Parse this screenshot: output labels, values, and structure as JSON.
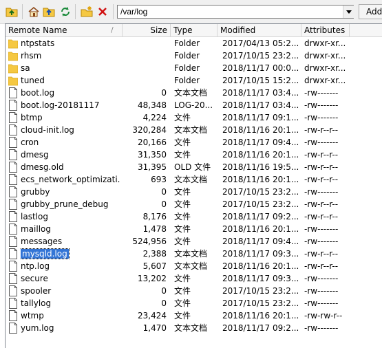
{
  "toolbar": {
    "path": "/var/log",
    "add_label": "Add",
    "icons": [
      "parent-folder-icon",
      "home-icon",
      "root-folder-icon",
      "refresh-icon",
      "new-folder-icon",
      "delete-icon"
    ]
  },
  "columns": {
    "name": "Remote Name",
    "size": "Size",
    "type": "Type",
    "modified": "Modified",
    "attributes": "Attributes",
    "sort_glyph": "/"
  },
  "files": [
    {
      "name": "ntpstats",
      "size": "",
      "type": "Folder",
      "modified": "2017/04/13 05:2...",
      "attributes": "drwxr-xr...",
      "kind": "folder"
    },
    {
      "name": "rhsm",
      "size": "",
      "type": "Folder",
      "modified": "2017/10/15 23:2...",
      "attributes": "drwxr-xr...",
      "kind": "folder"
    },
    {
      "name": "sa",
      "size": "",
      "type": "Folder",
      "modified": "2018/11/17 00:0...",
      "attributes": "drwxr-xr...",
      "kind": "folder"
    },
    {
      "name": "tuned",
      "size": "",
      "type": "Folder",
      "modified": "2017/10/15 15:2...",
      "attributes": "drwxr-xr...",
      "kind": "folder"
    },
    {
      "name": "boot.log",
      "size": "0",
      "type": "文本文档",
      "modified": "2018/11/17 03:4...",
      "attributes": "-rw-------",
      "kind": "file"
    },
    {
      "name": "boot.log-20181117",
      "size": "48,348",
      "type": "LOG-20...",
      "modified": "2018/11/17 03:4...",
      "attributes": "-rw-------",
      "kind": "file"
    },
    {
      "name": "btmp",
      "size": "4,224",
      "type": "文件",
      "modified": "2018/11/17 09:1...",
      "attributes": "-rw-------",
      "kind": "file"
    },
    {
      "name": "cloud-init.log",
      "size": "320,284",
      "type": "文本文档",
      "modified": "2018/11/16 20:1...",
      "attributes": "-rw-r--r--",
      "kind": "file"
    },
    {
      "name": "cron",
      "size": "20,166",
      "type": "文件",
      "modified": "2018/11/17 09:4...",
      "attributes": "-rw-------",
      "kind": "file"
    },
    {
      "name": "dmesg",
      "size": "31,350",
      "type": "文件",
      "modified": "2018/11/16 20:1...",
      "attributes": "-rw-r--r--",
      "kind": "file"
    },
    {
      "name": "dmesg.old",
      "size": "31,395",
      "type": "OLD 文件",
      "modified": "2018/11/16 19:5...",
      "attributes": "-rw-r--r--",
      "kind": "file"
    },
    {
      "name": "ecs_network_optimizati...",
      "size": "693",
      "type": "文本文档",
      "modified": "2018/11/16 20:1...",
      "attributes": "-rw-r--r--",
      "kind": "file"
    },
    {
      "name": "grubby",
      "size": "0",
      "type": "文件",
      "modified": "2017/10/15 23:2...",
      "attributes": "-rw-------",
      "kind": "file"
    },
    {
      "name": "grubby_prune_debug",
      "size": "0",
      "type": "文件",
      "modified": "2017/10/15 23:2...",
      "attributes": "-rw-r--r--",
      "kind": "file"
    },
    {
      "name": "lastlog",
      "size": "8,176",
      "type": "文件",
      "modified": "2018/11/17 09:2...",
      "attributes": "-rw-r--r--",
      "kind": "file"
    },
    {
      "name": "maillog",
      "size": "1,478",
      "type": "文件",
      "modified": "2018/11/16 20:1...",
      "attributes": "-rw-------",
      "kind": "file"
    },
    {
      "name": "messages",
      "size": "524,956",
      "type": "文件",
      "modified": "2018/11/17 09:4...",
      "attributes": "-rw-------",
      "kind": "file"
    },
    {
      "name": "mysqld.log",
      "size": "2,388",
      "type": "文本文档",
      "modified": "2018/11/17 09:3...",
      "attributes": "-rw-r--r--",
      "kind": "file",
      "selected": true
    },
    {
      "name": "ntp.log",
      "size": "5,607",
      "type": "文本文档",
      "modified": "2018/11/16 20:1...",
      "attributes": "-rw-r--r--",
      "kind": "file"
    },
    {
      "name": "secure",
      "size": "13,202",
      "type": "文件",
      "modified": "2018/11/17 09:3...",
      "attributes": "-rw-------",
      "kind": "file"
    },
    {
      "name": "spooler",
      "size": "0",
      "type": "文件",
      "modified": "2017/10/15 23:2...",
      "attributes": "-rw-------",
      "kind": "file"
    },
    {
      "name": "tallylog",
      "size": "0",
      "type": "文件",
      "modified": "2017/10/15 23:2...",
      "attributes": "-rw-------",
      "kind": "file"
    },
    {
      "name": "wtmp",
      "size": "23,424",
      "type": "文件",
      "modified": "2018/11/16 20:1...",
      "attributes": "-rw-rw-r--",
      "kind": "file"
    },
    {
      "name": "yum.log",
      "size": "1,470",
      "type": "文本文档",
      "modified": "2018/11/17 09:2...",
      "attributes": "-rw-------",
      "kind": "file"
    }
  ],
  "colors": {
    "folder": "#f5c842",
    "selection": "#3375d6"
  }
}
